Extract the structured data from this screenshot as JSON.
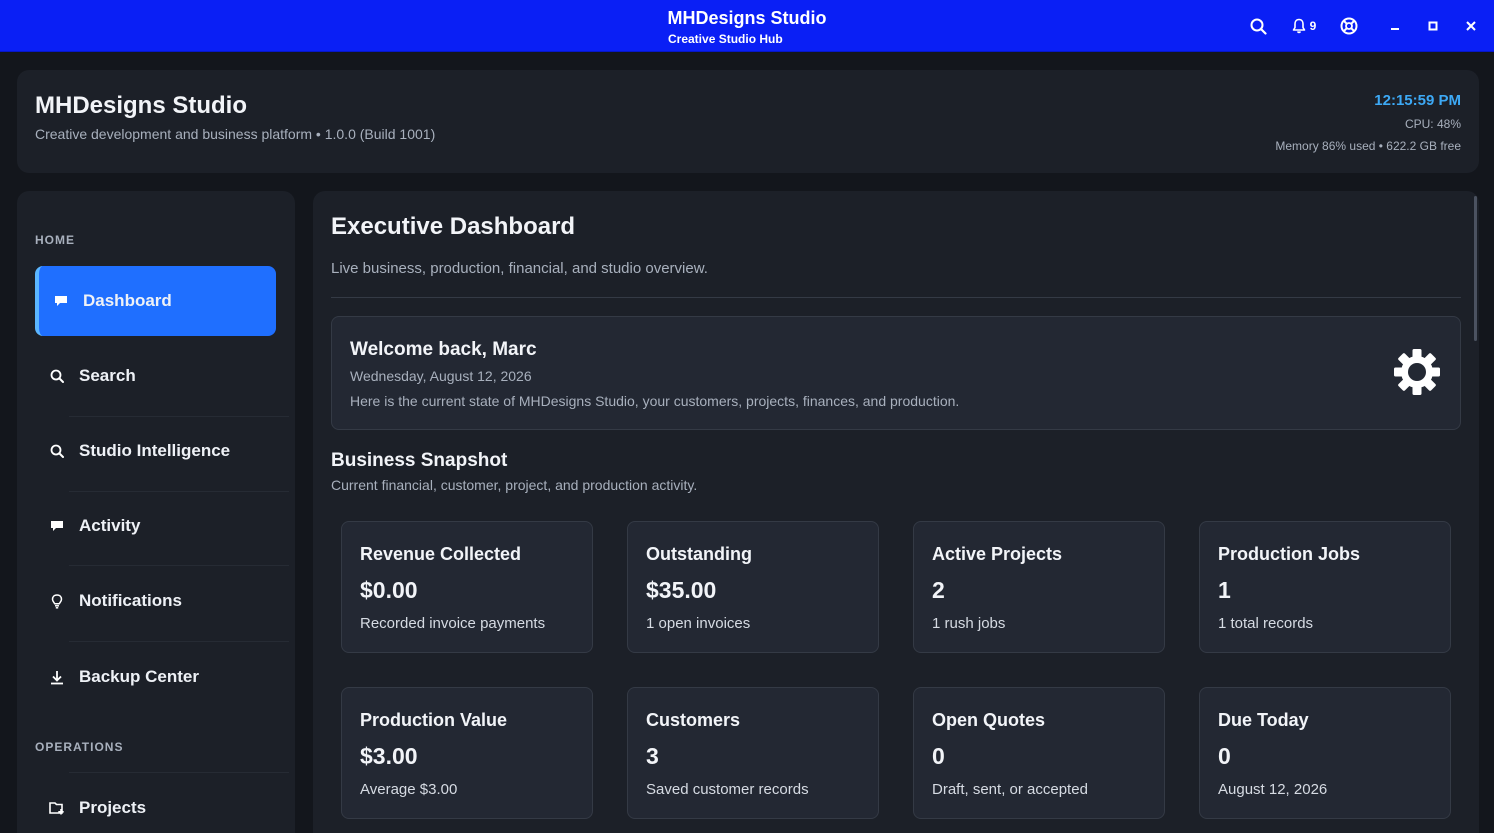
{
  "titlebar": {
    "title": "MHDesigns Studio",
    "subtitle": "Creative Studio Hub",
    "notification_count": "9",
    "icons": [
      "search-icon",
      "bell-icon",
      "help-icon",
      "minimize-icon",
      "maximize-icon",
      "close-icon"
    ]
  },
  "header": {
    "title": "MHDesigns Studio",
    "subtitle": "Creative development and business platform • 1.0.0 (Build 1001)",
    "time": "12:15:59 PM",
    "cpu": "CPU: 48%",
    "memory": "Memory 86% used • 622.2 GB free"
  },
  "sidebar": {
    "sections": {
      "home": "HOME",
      "operations": "OPERATIONS"
    },
    "items": [
      {
        "label": "Dashboard",
        "icon": "chat-icon",
        "active": true
      },
      {
        "label": "Search",
        "icon": "search-icon"
      },
      {
        "label": "Studio Intelligence",
        "icon": "search-icon"
      },
      {
        "label": "Activity",
        "icon": "chat-icon"
      },
      {
        "label": "Notifications",
        "icon": "bulb-icon"
      },
      {
        "label": "Backup Center",
        "icon": "download-icon"
      },
      {
        "label": "Projects",
        "icon": "folder-add-icon"
      }
    ]
  },
  "main": {
    "title": "Executive Dashboard",
    "subtitle": "Live business, production, financial, and studio overview.",
    "welcome": {
      "title": "Welcome back, Marc",
      "date": "Wednesday, August 12, 2026",
      "text": "Here is the current state of MHDesigns Studio, your customers, projects, finances, and production."
    },
    "snapshot": {
      "title": "Business Snapshot",
      "subtitle": "Current financial, customer, project, and production activity."
    },
    "stats": [
      {
        "label": "Revenue Collected",
        "value": "$0.00",
        "note": "Recorded invoice payments"
      },
      {
        "label": "Outstanding",
        "value": "$35.00",
        "note": "1 open invoices"
      },
      {
        "label": "Active Projects",
        "value": "2",
        "note": "1 rush jobs"
      },
      {
        "label": "Production Jobs",
        "value": "1",
        "note": "1 total records"
      },
      {
        "label": "Production Value",
        "value": "$3.00",
        "note": "Average $3.00"
      },
      {
        "label": "Customers",
        "value": "3",
        "note": "Saved customer records"
      },
      {
        "label": "Open Quotes",
        "value": "0",
        "note": "Draft, sent, or accepted"
      },
      {
        "label": "Due Today",
        "value": "0",
        "note": "August 12, 2026"
      }
    ]
  },
  "colors": {
    "titlebar": "#0a1ff5",
    "accent": "#1f6fff",
    "time": "#3da9f5",
    "panel": "#1c2028",
    "background": "#13161c"
  }
}
